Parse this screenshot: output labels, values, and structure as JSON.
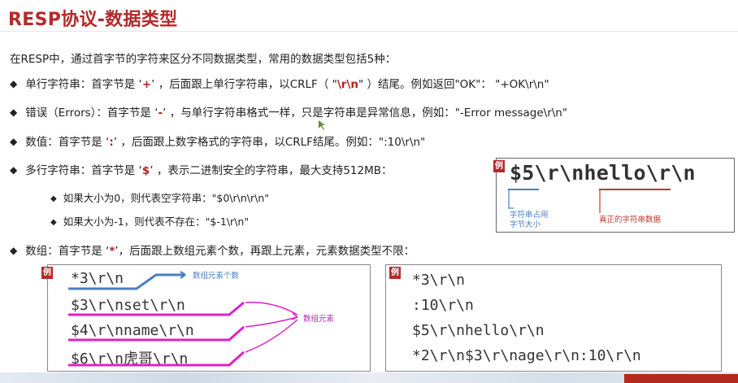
{
  "title": "RESP协议-数据类型",
  "intro": "在RESP中，通过首字节的字符来区分不同数据类型，常用的数据类型包括5种：",
  "bullets": {
    "simple": {
      "pre": "单行字符串：首字节是 ‘",
      "mark": "+",
      "mid": "’ ，后面跟上单行字符串，以CRLF（ \"",
      "crlf": "\\r\\n",
      "post": "\" ）结尾。例如返回\"OK\"： \"+OK\\r\\n\""
    },
    "error": {
      "pre": "错误（Errors）：首字节是 ‘",
      "mark": "-",
      "post": "’ ，与单行字符串格式一样，只是字符串是异常信息，例如：\"-Error message\\r\\n\""
    },
    "integer": {
      "pre": "数值：首字节是 ‘",
      "mark": ":",
      "post": "’ ，后面跟上数字格式的字符串，以CRLF结尾。例如：\":10\\r\\n\""
    },
    "bulk": {
      "pre": "多行字符串：首字节是 ‘",
      "mark": "$",
      "post": "’ ，表示二进制安全的字符串，最大支持512MB："
    },
    "bulk_sub1": "如果大小为0，则代表空字符串：\"$0\\r\\n\\r\\n\"",
    "bulk_sub2": "如果大小为-1，则代表不存在：\"$-1\\r\\n\"",
    "array": {
      "pre": "数组：首字节是 ‘",
      "mark": "*",
      "post": "’，后面跟上数组元素个数，再跟上元素，元素数据类型不限："
    }
  },
  "example_tag": "例",
  "bulk_example": {
    "code": "$5\\r\\nhello\\r\\n",
    "ann_len_1": "字符串占用",
    "ann_len_2": "字节大小",
    "ann_data": "真正的字符串数据"
  },
  "array_example_left": {
    "lines": [
      "*3\\r\\n",
      "$3\\r\\nset\\r\\n",
      "$4\\r\\nname\\r\\n",
      "$6\\r\\n虎哥\\r\\n"
    ],
    "ann_count": "数组元素个数",
    "ann_elements": "数组元素"
  },
  "array_example_right": {
    "lines": [
      "*3\\r\\n",
      ":10\\r\\n",
      "$5\\r\\nhello\\r\\n",
      "*2\\r\\n$3\\r\\nage\\r\\n:10\\r\\n"
    ]
  },
  "colors": {
    "title": "#b32a2a",
    "mark": "#b21f1f",
    "pink": "#e020c8",
    "blue": "#4a7fc1",
    "tag": "#b32a2a"
  }
}
